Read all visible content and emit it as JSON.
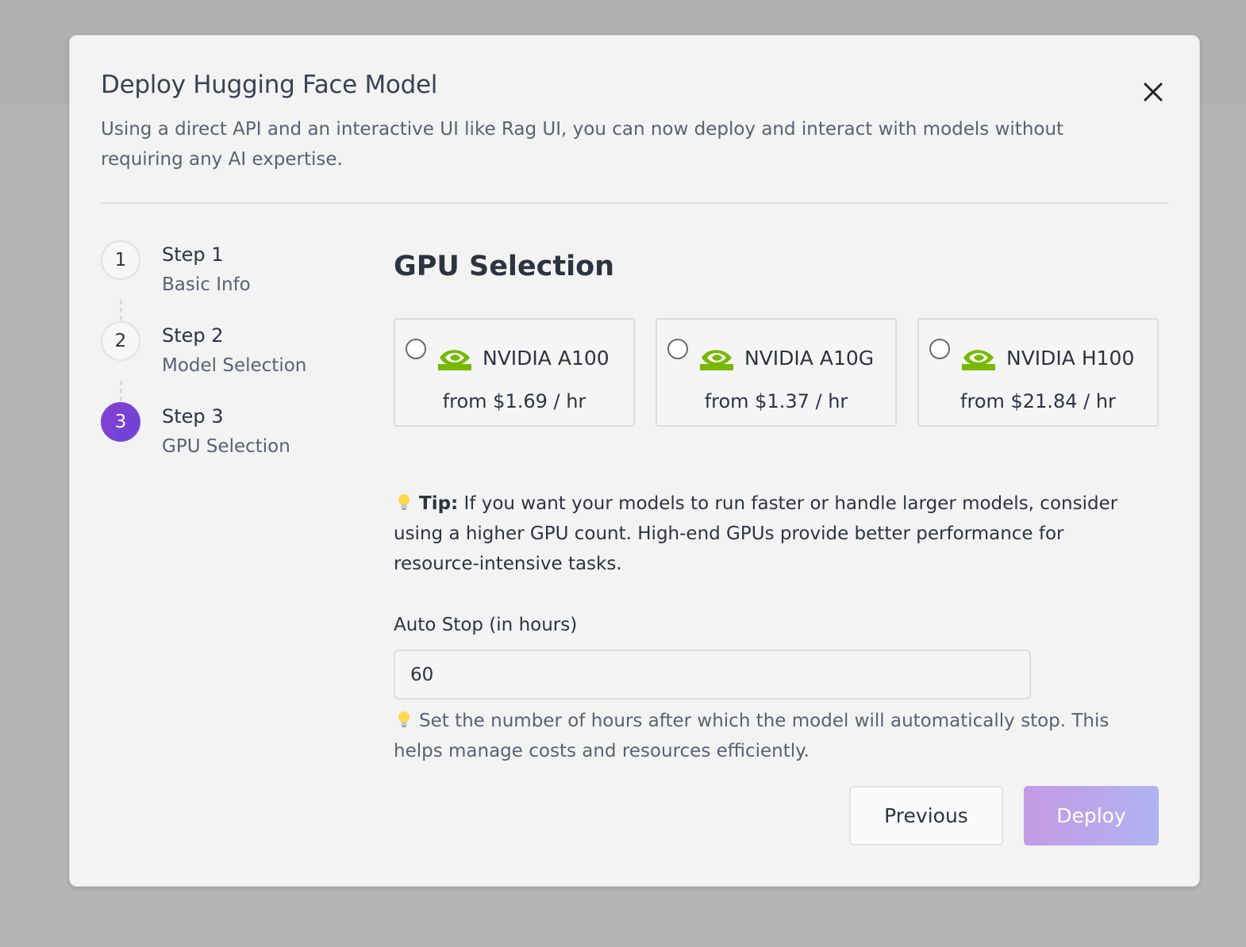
{
  "modal": {
    "title": "Deploy Hugging Face Model",
    "subtitle": "Using a direct API and an interactive UI like Rag UI, you can now deploy and interact with models without requiring any AI expertise."
  },
  "steps": [
    {
      "number": "1",
      "title": "Step 1",
      "subtitle": "Basic Info",
      "active": false
    },
    {
      "number": "2",
      "title": "Step 2",
      "subtitle": "Model Selection",
      "active": false
    },
    {
      "number": "3",
      "title": "Step 3",
      "subtitle": "GPU Selection",
      "active": true
    }
  ],
  "gpu_section": {
    "title": "GPU Selection",
    "options": [
      {
        "name": "NVIDIA A100",
        "price": "from $1.69 / hr",
        "selected": false
      },
      {
        "name": "NVIDIA A10G",
        "price": "from $1.37 / hr",
        "selected": false
      },
      {
        "name": "NVIDIA H100",
        "price": "from $21.84 / hr",
        "selected": false
      }
    ]
  },
  "tip": {
    "label": "Tip:",
    "text": " If you want your models to run faster or handle larger models, consider using a higher GPU count. High-end GPUs provide better performance for resource-intensive tasks."
  },
  "auto_stop": {
    "label": "Auto Stop (in hours)",
    "value": "60",
    "hint": "Set the number of hours after which the model will automatically stop. This helps manage costs and resources efficiently."
  },
  "buttons": {
    "previous": "Previous",
    "deploy": "Deploy"
  },
  "colors": {
    "accent": "#7b48d6",
    "nvidia_green": "#76b900",
    "deploy_start": "#c59ae4",
    "deploy_end": "#b0b4f2"
  },
  "icons": {
    "close": "close-icon",
    "gpu_logo": "nvidia-logo-icon",
    "tip": "lightbulb-icon"
  }
}
